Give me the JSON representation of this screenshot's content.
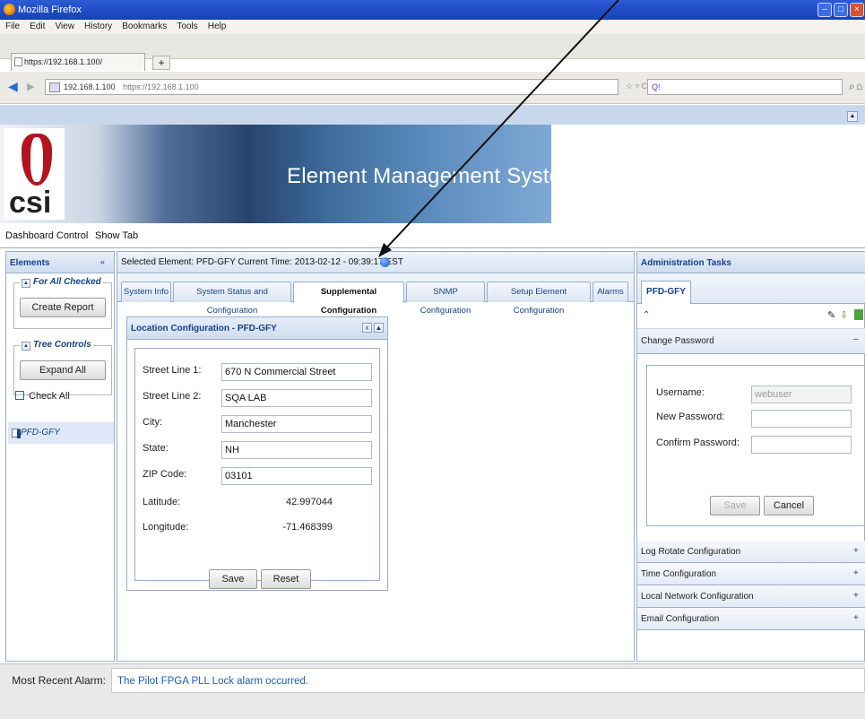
{
  "window": {
    "title": "Mozilla Firefox"
  },
  "menu": [
    "File",
    "Edit",
    "View",
    "History",
    "Bookmarks",
    "Tools",
    "Help"
  ],
  "browser": {
    "tab_title": "https://192.168.1.100/",
    "new_tab": "+",
    "url_host": "192.168.1.100",
    "url_full": "https://192.168.1.100",
    "search_placeholder": "Q!"
  },
  "banner": {
    "title": "Element Management System",
    "logo_text": "csi"
  },
  "dashboard": {
    "control": "Dashboard Control",
    "show_tab": "Show Tab"
  },
  "left": {
    "header": "Elements",
    "for_all_checked": "For All Checked",
    "create_report": "Create Report",
    "tree_controls": "Tree Controls",
    "expand_all": "Expand All",
    "check_all": "Check All",
    "node": "PFD-GFY"
  },
  "center": {
    "selected_info": "Selected Element: PFD-GFY  Current Time: 2013-02-12 - 09:39:17 EST",
    "tabs": [
      "System Info",
      "System Status and Configuration",
      "Supplemental Configuration",
      "SNMP Configuration",
      "Setup Element Configuration",
      "Alarms"
    ],
    "location_title": "Location Configuration - PFD-GFY",
    "labels": {
      "street1": "Street Line 1:",
      "street2": "Street Line 2:",
      "city": "City:",
      "state": "State:",
      "zip": "ZIP Code:",
      "lat": "Latitude:",
      "lon": "Longitude:"
    },
    "values": {
      "street1": "670 N Commercial Street",
      "street2": "SQA LAB",
      "city": "Manchester",
      "state": "NH",
      "zip": "03101",
      "lat": "42.997044",
      "lon": "-71.468399"
    },
    "save": "Save",
    "reset": "Reset"
  },
  "right": {
    "header": "Administration Tasks",
    "tab": "PFD-GFY",
    "change_password": "Change Password",
    "username_label": "Username:",
    "username_value": "webuser",
    "new_password_label": "New Password:",
    "confirm_password_label": "Confirm Password:",
    "save": "Save",
    "cancel": "Cancel",
    "sections": [
      "Log Rotate Configuration",
      "Time Configuration",
      "Local Network Configuration",
      "Email Configuration"
    ]
  },
  "footer": {
    "label": "Most Recent Alarm:",
    "message": "The Pilot FPGA PLL Lock alarm occurred."
  }
}
